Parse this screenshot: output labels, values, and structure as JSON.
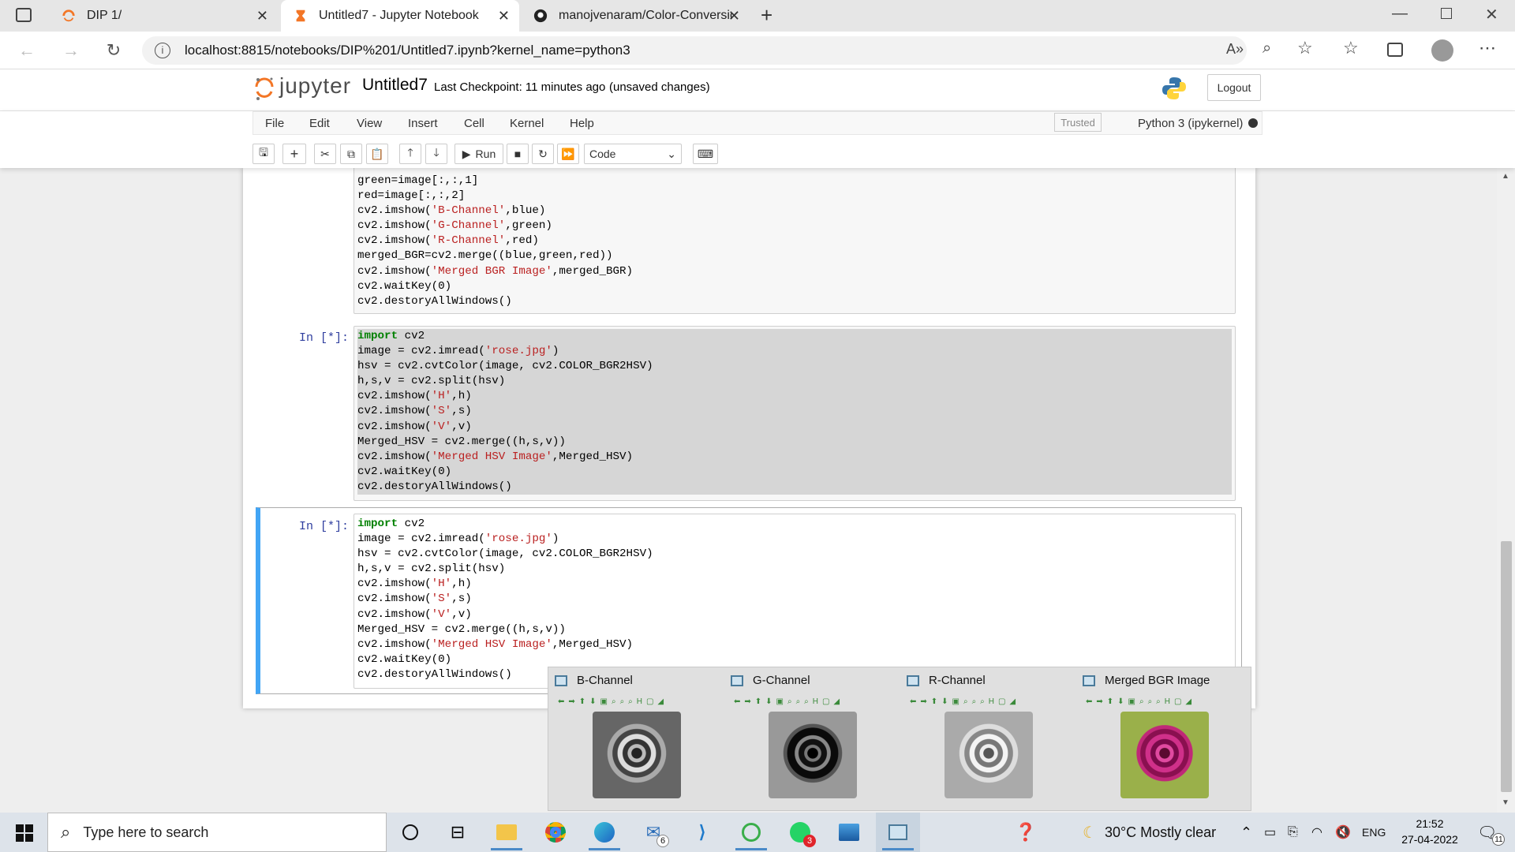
{
  "browser": {
    "tabs": [
      {
        "title": "DIP 1/",
        "icon": "jupyter-icon",
        "active": false
      },
      {
        "title": "Untitled7 - Jupyter Notebook",
        "icon": "hourglass-icon",
        "active": true
      },
      {
        "title": "manojvenaram/Color-Conversion",
        "icon": "github-icon",
        "active": false
      }
    ],
    "url": "localhost:8815/notebooks/DIP%201/Untitled7.ipynb?kernel_name=python3"
  },
  "jupyter": {
    "logo_text": "jupyter",
    "notebook_name": "Untitled7",
    "checkpoint": "Last Checkpoint: 11 minutes ago",
    "unsaved": "(unsaved changes)",
    "logout_label": "Logout",
    "menu": [
      "File",
      "Edit",
      "View",
      "Insert",
      "Cell",
      "Kernel",
      "Help"
    ],
    "trusted_label": "Trusted",
    "kernel_label": "Python 3 (ipykernel)",
    "run_label": "Run",
    "cell_type": "Code"
  },
  "cells": [
    {
      "prompt": "",
      "lines": [
        "green=image[:,:,1]",
        "red=image[:,:,2]",
        "cv2.imshow('B-Channel',blue)",
        "cv2.imshow('G-Channel',green)",
        "cv2.imshow('R-Channel',red)",
        "merged_BGR=cv2.merge((blue,green,red))",
        "cv2.imshow('Merged BGR Image',merged_BGR)",
        "cv2.waitKey(0)",
        "cv2.destoryAllWindows()"
      ]
    },
    {
      "prompt": "In [*]:",
      "lines": [
        "import cv2",
        "image = cv2.imread('rose.jpg')",
        "hsv = cv2.cvtColor(image, cv2.COLOR_BGR2HSV)",
        "h,s,v = cv2.split(hsv)",
        "cv2.imshow('H',h)",
        "cv2.imshow('S',s)",
        "cv2.imshow('V',v)",
        "Merged_HSV = cv2.merge((h,s,v))",
        "cv2.imshow('Merged HSV Image',Merged_HSV)",
        "cv2.waitKey(0)",
        "cv2.destoryAllWindows()"
      ]
    },
    {
      "prompt": "In [*]:",
      "lines": [
        "import cv2",
        "image = cv2.imread('rose.jpg')",
        "hsv = cv2.cvtColor(image, cv2.COLOR_BGR2HSV)",
        "h,s,v = cv2.split(hsv)",
        "cv2.imshow('H',h)",
        "cv2.imshow('S',s)",
        "cv2.imshow('V',v)",
        "Merged_HSV = cv2.merge((h,s,v))",
        "cv2.imshow('Merged HSV Image',Merged_HSV)",
        "cv2.waitKey(0)",
        "cv2.destoryAllWindows()"
      ]
    }
  ],
  "thumbnails": [
    {
      "title": "B-Channel",
      "tone": "gray"
    },
    {
      "title": "G-Channel",
      "tone": "dark"
    },
    {
      "title": "R-Channel",
      "tone": "light"
    },
    {
      "title": "Merged BGR Image",
      "tone": "color"
    }
  ],
  "taskbar": {
    "search_placeholder": "Type here to search",
    "mail_badge": "6",
    "whatsapp_badge": "3",
    "weather": "30°C  Mostly clear",
    "lang": "ENG",
    "time": "21:52",
    "date": "27-04-2022",
    "notif_badge": "11"
  },
  "colors": {
    "accent": "#42a5f5",
    "keyword": "#008000",
    "string": "#ba2121",
    "prompt": "#303f9f"
  }
}
